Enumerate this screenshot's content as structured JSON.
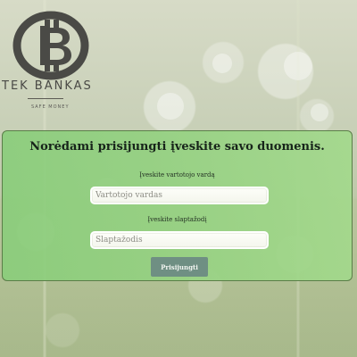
{
  "brand": {
    "name": "TEK BANKAS",
    "tagline": "SAFE MONEY",
    "logo_icon": "bitcoin-coin-icon"
  },
  "login": {
    "title": "Norėdami prisijungti įveskite savo duomenis.",
    "username_label": "Įveskite vartotojo vardą",
    "username_placeholder": "Vartotojo vardas",
    "password_label": "Įveskite slaptažodį",
    "password_placeholder": "Slaptažodis",
    "submit_label": "Prisijungti"
  },
  "colors": {
    "panel_green": "#93d180",
    "button_gray_green": "#6f8f83",
    "logo_dark": "#4a4a46"
  }
}
